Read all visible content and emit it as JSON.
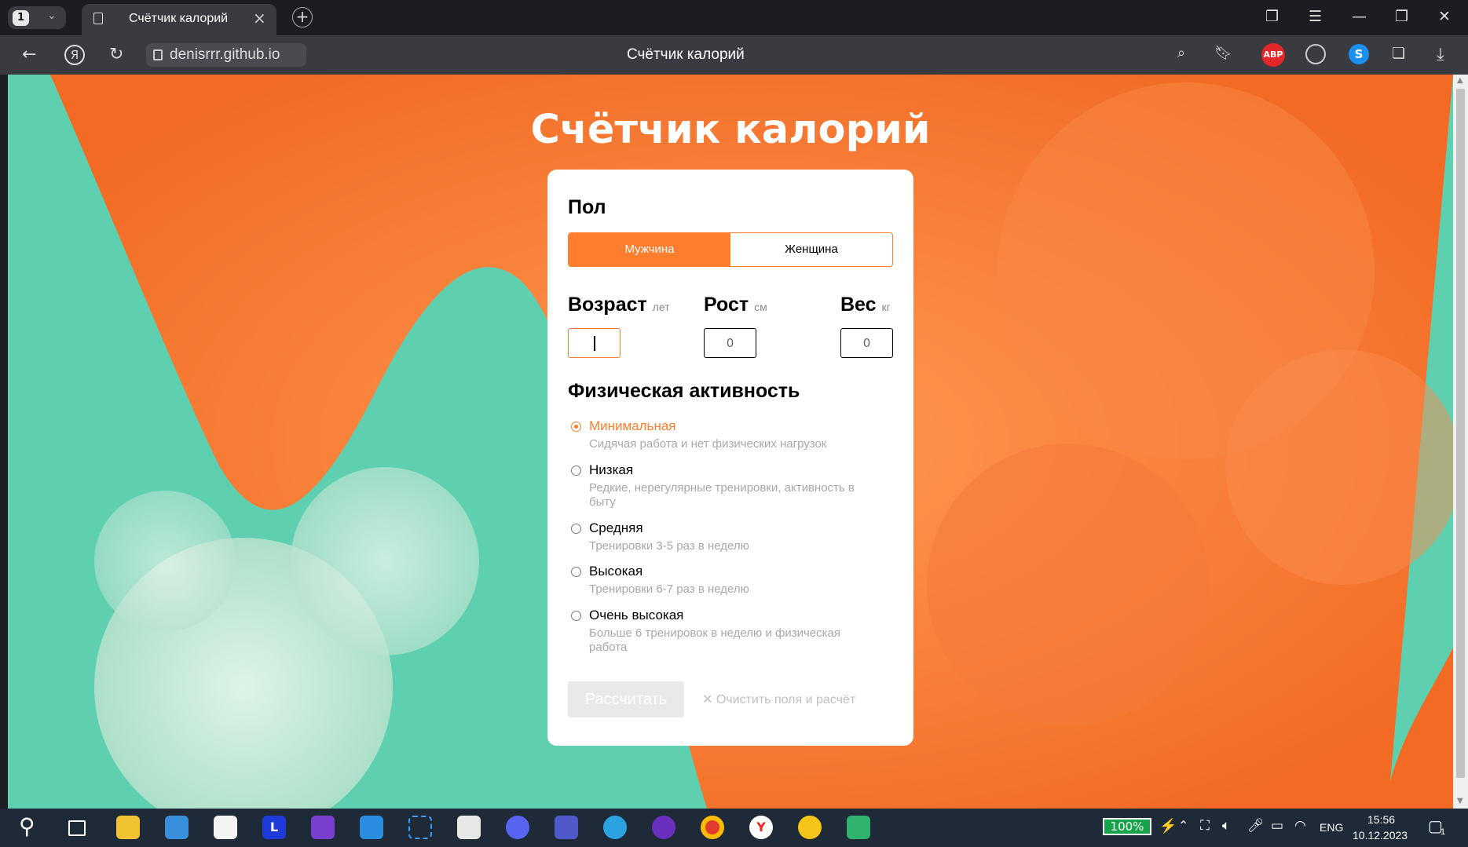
{
  "browser": {
    "tab_count": "1",
    "tab_title": "Счётчик калорий",
    "url": "denisrrr.github.io",
    "page_title": "Счётчик калорий",
    "abp_label": "ABP"
  },
  "page": {
    "title": "Счётчик калорий",
    "gender": {
      "heading": "Пол",
      "options": [
        "Мужчина",
        "Женщина"
      ],
      "selected": "Мужчина"
    },
    "params": {
      "age": {
        "label": "Возраст",
        "unit": "лет",
        "value": ""
      },
      "height": {
        "label": "Рост",
        "unit": "см",
        "value": "0"
      },
      "weight": {
        "label": "Вес",
        "unit": "кг",
        "value": "0"
      }
    },
    "activity": {
      "heading": "Физическая активность",
      "options": [
        {
          "label": "Минимальная",
          "desc": "Сидячая работа и нет физических нагрузок",
          "selected": true
        },
        {
          "label": "Низкая",
          "desc": "Редкие, нерегулярные тренировки, активность в быту",
          "selected": false
        },
        {
          "label": "Средняя",
          "desc": "Тренировки 3-5 раз в неделю",
          "selected": false
        },
        {
          "label": "Высокая",
          "desc": "Тренировки 6-7 раз в неделю",
          "selected": false
        },
        {
          "label": "Очень высокая",
          "desc": "Больше 6 тренировок в неделю и физическая работа",
          "selected": false
        }
      ]
    },
    "calculate_label": "Рассчитать",
    "reset_label": "Очистить поля и расчёт"
  },
  "taskbar": {
    "battery": "100%",
    "lang": "ENG",
    "time": "15:56",
    "date": "10.12.2023",
    "notification_count": "1"
  },
  "colors": {
    "accent": "#ff7d2c",
    "mint": "#5ed0b0",
    "taskbar": "#1e2a37"
  }
}
